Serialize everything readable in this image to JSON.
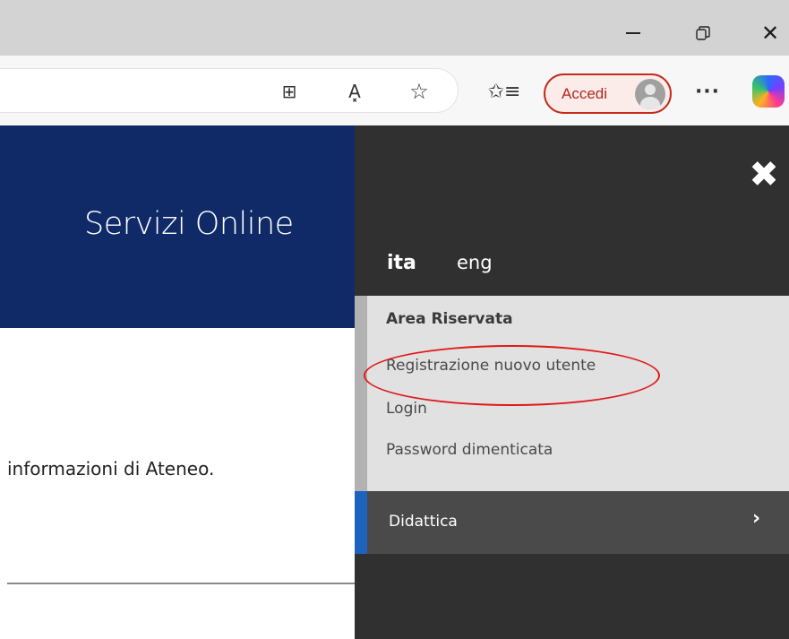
{
  "window": {
    "minimize_icon": "minimize-icon",
    "restore_icon": "restore-icon",
    "close_glyph": "✕"
  },
  "toolbar": {
    "split_glyph": "⊞",
    "read_glyph": "A͓",
    "star_glyph": "☆",
    "favorites_glyph": "✩≡",
    "accedi_label": "Accedi",
    "more_glyph": "···"
  },
  "page": {
    "title": "Servizi Online",
    "body_text": "informazioni di Ateneo."
  },
  "menu": {
    "close_glyph": "✖",
    "languages": {
      "ita": "ita",
      "eng": "eng"
    },
    "area": {
      "title": "Area Riservata",
      "items": [
        "Registrazione nuovo utente",
        "Login",
        "Password dimenticata"
      ]
    },
    "didattica": {
      "label": "Didattica",
      "chevron": "›"
    }
  },
  "colors": {
    "header_blue": "#102a68",
    "menu_dark": "#303030",
    "accent_blue": "#1e62c0",
    "annotation_red": "#e01818",
    "accedi_red": "#c42b1c"
  }
}
